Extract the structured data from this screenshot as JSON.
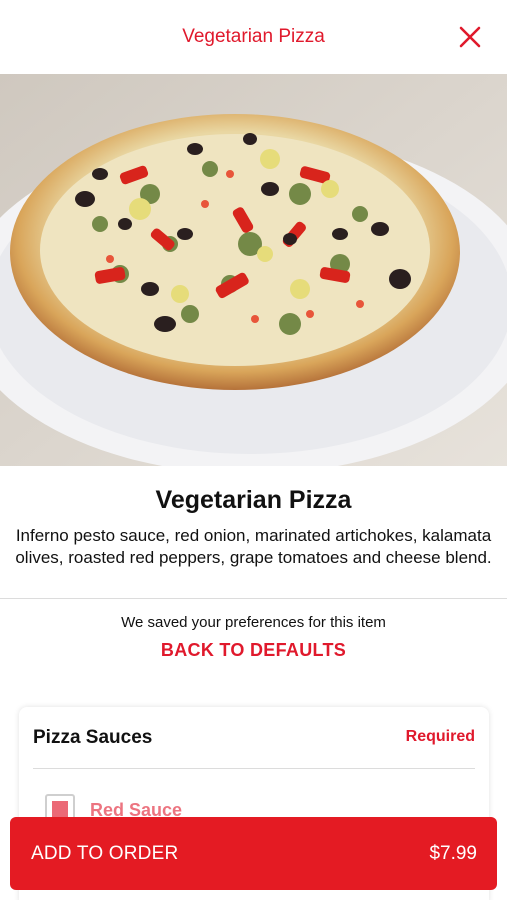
{
  "header": {
    "title": "Vegetarian Pizza",
    "close_icon": "close-icon"
  },
  "hero": {
    "icon": "pizza-photo"
  },
  "item": {
    "name": "Vegetarian Pizza",
    "description": "Inferno pesto sauce, red onion, marinated artichokes, kalamata olives, roasted red peppers, grape tomatoes and cheese blend."
  },
  "preferences": {
    "note": "We saved your preferences for this item",
    "back_label": "BACK TO DEFAULTS"
  },
  "section": {
    "title": "Pizza Sauces",
    "required_label": "Required",
    "options": [
      {
        "label": "Red Sauce"
      }
    ]
  },
  "order": {
    "label": "ADD TO ORDER",
    "price": "$7.99"
  },
  "colors": {
    "accent": "#e0192c",
    "button": "#e41b23"
  }
}
